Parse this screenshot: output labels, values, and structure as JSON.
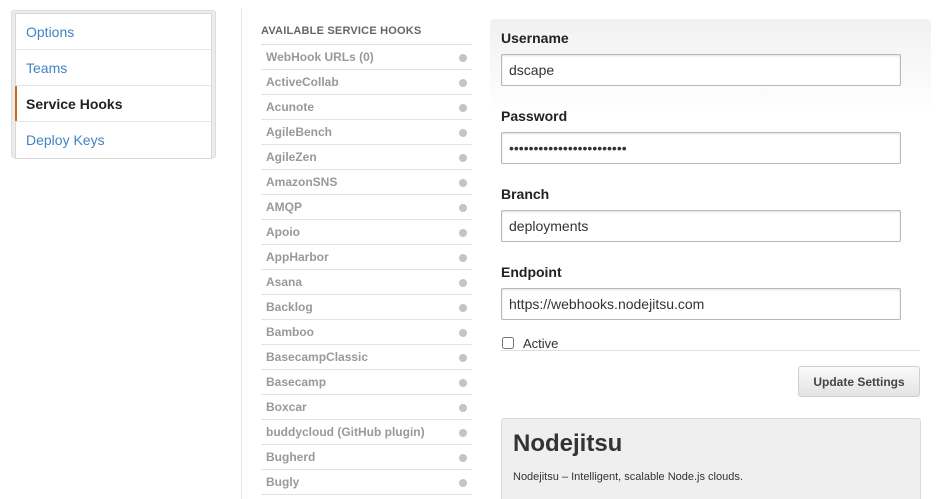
{
  "menu": {
    "items": [
      {
        "label": "Options"
      },
      {
        "label": "Teams"
      },
      {
        "label": "Service Hooks"
      },
      {
        "label": "Deploy Keys"
      }
    ]
  },
  "hooks": {
    "heading": "AVAILABLE SERVICE HOOKS",
    "items": [
      "WebHook URLs (0)",
      "ActiveCollab",
      "Acunote",
      "AgileBench",
      "AgileZen",
      "AmazonSNS",
      "AMQP",
      "Apoio",
      "AppHarbor",
      "Asana",
      "Backlog",
      "Bamboo",
      "BasecampClassic",
      "Basecamp",
      "Boxcar",
      "buddycloud (GitHub plugin)",
      "Bugherd",
      "Bugly"
    ]
  },
  "form": {
    "username_label": "Username",
    "username_value": "dscape",
    "password_label": "Password",
    "password_value": "••••••••••••••••••••••••",
    "branch_label": "Branch",
    "branch_value": "deployments",
    "endpoint_label": "Endpoint",
    "endpoint_value": "https://webhooks.nodejitsu.com",
    "active_label": "Active",
    "update_button": "Update Settings"
  },
  "info": {
    "title": "Nodejitsu",
    "description": "Nodejitsu – Intelligent, scalable Node.js clouds."
  },
  "colors": {
    "link": "#4183c4",
    "active_marker": "#d26911"
  }
}
